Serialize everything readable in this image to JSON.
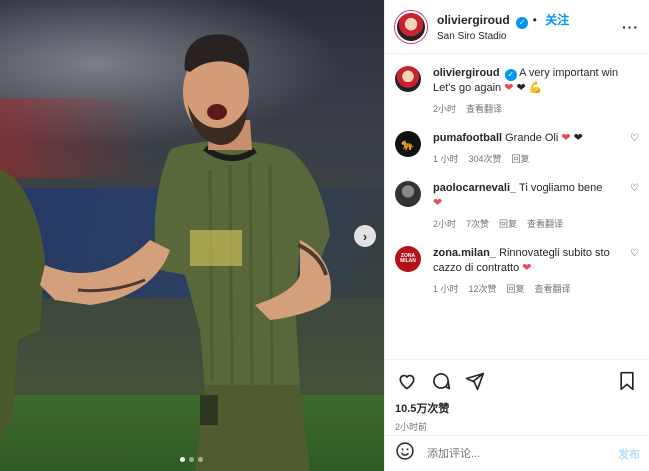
{
  "post": {
    "username": "oliviergiroud",
    "follow_label": "关注",
    "location": "San Siro Stadio",
    "more_label": "···"
  },
  "media": {
    "next_arrow": "›",
    "carousel_dots": 3,
    "active_dot": 0
  },
  "caption": {
    "username": "oliviergiroud",
    "text_line1": "A very important win",
    "text_line2": "Let's go again",
    "emoji": [
      "❤",
      "❤",
      "💪"
    ],
    "time": "2小时",
    "translate": "查看翻译"
  },
  "comments": [
    {
      "username": "pumafootball",
      "text": "Grande Oli",
      "time": "1 小时",
      "likes": "304次赞",
      "reply": "回复",
      "avatar_icon": "puma-logo-icon"
    },
    {
      "username": "paolocarnevali_",
      "text": "Ti vogliamo bene",
      "time": "2小时",
      "likes": "7次赞",
      "reply": "回复",
      "translate": "查看翻译",
      "avatar_icon": "user-photo-icon"
    },
    {
      "username": "zona.milan_",
      "text": "Rinnovategli subito sto cazzo di contratto",
      "time": "1 小时",
      "likes": "12次赞",
      "reply": "回复",
      "translate": "查看翻译",
      "avatar_text": "ZONA MILAN"
    }
  ],
  "actions": {
    "likes": "10.5万次赞",
    "time": "2小时前"
  },
  "add_comment": {
    "placeholder": "添加评论...",
    "post_label": "发布"
  },
  "colors": {
    "accent": "#0095f6",
    "heart_red": "#ed4956",
    "muted": "#737373"
  }
}
